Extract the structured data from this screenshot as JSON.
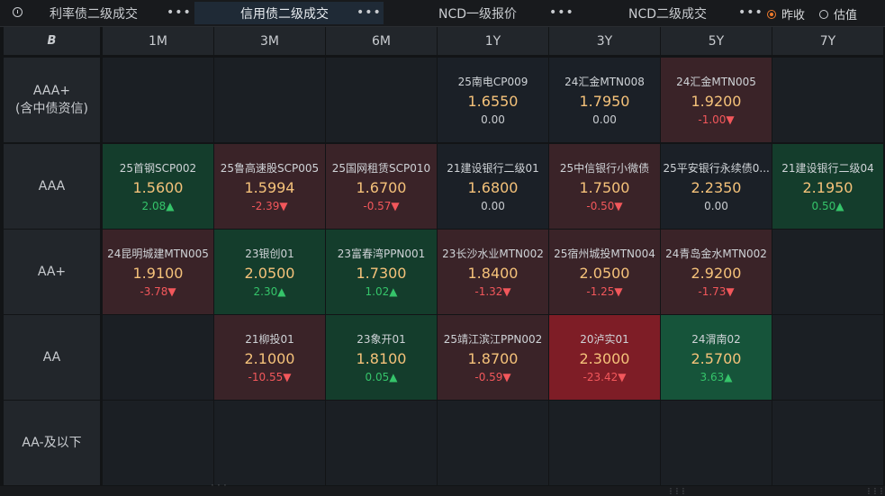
{
  "tabs": [
    {
      "label": "利率债二级成交",
      "more": "•••"
    },
    {
      "label": "信用债二级成交",
      "more": "•••"
    },
    {
      "label": "NCD一级报价",
      "more": "•••"
    },
    {
      "label": "NCD二级成交",
      "more": "•••"
    }
  ],
  "active_tab": 1,
  "radio": {
    "option1": "昨收",
    "option2": "估值",
    "selected": "昨收"
  },
  "colors": {
    "accent": "#f07b2c",
    "rate": "#f5c27a",
    "up": "#35c46a",
    "down": "#f2575b"
  },
  "corner_logo": "B",
  "columns": [
    "1M",
    "3M",
    "6M",
    "1Y",
    "3Y",
    "5Y",
    "7Y"
  ],
  "rows": [
    {
      "label_line1": "AAA+",
      "label_line2": "(含中债资信)",
      "cells": [
        {
          "style": "empty"
        },
        {
          "style": "empty"
        },
        {
          "style": "empty"
        },
        {
          "name": "25南电CP009",
          "rate": "1.6550",
          "chg": "0.00",
          "dir": "flat",
          "style": "neutral"
        },
        {
          "name": "24汇金MTN008",
          "rate": "1.7950",
          "chg": "0.00",
          "dir": "flat",
          "style": "neutral"
        },
        {
          "name": "24汇金MTN005",
          "rate": "1.9200",
          "chg": "-1.00▼",
          "dir": "down",
          "style": "red1"
        },
        {
          "style": "empty"
        }
      ]
    },
    {
      "label_line1": "AAA",
      "label_line2": "",
      "cells": [
        {
          "name": "25首钢SCP002",
          "rate": "1.5600",
          "chg": "2.08▲",
          "dir": "up",
          "style": "green1"
        },
        {
          "name": "25鲁高速股SCP005",
          "rate": "1.5994",
          "chg": "-2.39▼",
          "dir": "down",
          "style": "red1"
        },
        {
          "name": "25国网租赁SCP010",
          "rate": "1.6700",
          "chg": "-0.57▼",
          "dir": "down",
          "style": "red1"
        },
        {
          "name": "21建设银行二级01",
          "rate": "1.6800",
          "chg": "0.00",
          "dir": "flat",
          "style": "neutral"
        },
        {
          "name": "25中信银行小微债",
          "rate": "1.7500",
          "chg": "-0.50▼",
          "dir": "down",
          "style": "red1"
        },
        {
          "name": "25平安银行永续债0...",
          "rate": "2.2350",
          "chg": "0.00",
          "dir": "flat",
          "style": "neutral"
        },
        {
          "name": "21建设银行二级04",
          "rate": "2.1950",
          "chg": "0.50▲",
          "dir": "up",
          "style": "green1"
        }
      ]
    },
    {
      "label_line1": "AA+",
      "label_line2": "",
      "cells": [
        {
          "name": "24昆明城建MTN005",
          "rate": "1.9100",
          "chg": "-3.78▼",
          "dir": "down",
          "style": "red1"
        },
        {
          "name": "23银创01",
          "rate": "2.0500",
          "chg": "2.30▲",
          "dir": "up",
          "style": "green1"
        },
        {
          "name": "23富春湾PPN001",
          "rate": "1.7300",
          "chg": "1.02▲",
          "dir": "up",
          "style": "green1"
        },
        {
          "name": "23长沙水业MTN002",
          "rate": "1.8400",
          "chg": "-1.32▼",
          "dir": "down",
          "style": "red1"
        },
        {
          "name": "25宿州城投MTN004",
          "rate": "2.0500",
          "chg": "-1.25▼",
          "dir": "down",
          "style": "red1"
        },
        {
          "name": "24青岛金水MTN002",
          "rate": "2.9200",
          "chg": "-1.73▼",
          "dir": "down",
          "style": "red1"
        },
        {
          "style": "empty"
        }
      ]
    },
    {
      "label_line1": "AA",
      "label_line2": "",
      "cells": [
        {
          "style": "empty"
        },
        {
          "name": "21柳投01",
          "rate": "2.1000",
          "chg": "-10.55▼",
          "dir": "down",
          "style": "red1"
        },
        {
          "name": "23象开01",
          "rate": "1.8100",
          "chg": "0.05▲",
          "dir": "up",
          "style": "green1"
        },
        {
          "name": "25靖江滨江PPN002",
          "rate": "1.8700",
          "chg": "-0.59▼",
          "dir": "down",
          "style": "red1"
        },
        {
          "name": "20泸实01",
          "rate": "2.3000",
          "chg": "-23.42▼",
          "dir": "down",
          "style": "red2"
        },
        {
          "name": "24渭南02",
          "rate": "2.5700",
          "chg": "3.63▲",
          "dir": "up",
          "style": "green2"
        },
        {
          "style": "empty"
        }
      ]
    },
    {
      "label_line1": "AA-及以下",
      "label_line2": "",
      "cells": [
        {
          "style": "empty"
        },
        {
          "style": "empty"
        },
        {
          "style": "empty"
        },
        {
          "style": "empty"
        },
        {
          "style": "empty"
        },
        {
          "style": "empty"
        },
        {
          "style": "empty"
        }
      ]
    }
  ]
}
